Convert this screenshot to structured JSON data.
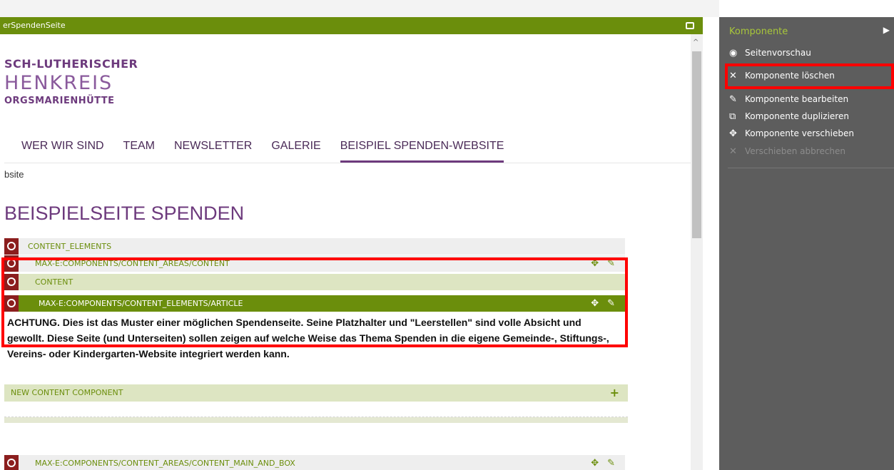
{
  "window": {
    "title": "erSpendenSeite"
  },
  "site": {
    "logo_line1": "SCH-LUTHERISCHER",
    "logo_line2": "HENKREIS",
    "logo_line3": "ORGSMARIENHÜTTE",
    "nav": [
      "WER WIR SIND",
      "TEAM",
      "NEWSLETTER",
      "GALERIE",
      "BEISPIEL SPENDEN-WEBSITE"
    ],
    "breadcrumb": "bsite",
    "page_title": "BEISPIELSEITE SPENDEN"
  },
  "components": {
    "content_elements": "CONTENT_ELEMENTS",
    "content_area": "MAX-E:COMPONENTS/CONTENT_AREAS/CONTENT",
    "content": "CONTENT",
    "article": "MAX-E:COMPONENTS/CONTENT_ELEMENTS/ARTICLE",
    "article_text": "ACHTUNG. Dies ist das Muster einer möglichen Spendenseite. Seine Platzhalter und \"Leerstellen\" sind volle Absicht und gewollt. Diese Seite (und Unterseiten) sollen zeigen auf welche Weise das Thema Spenden in die eigene Gemeinde-, Stiftungs-, Vereins- oder Kindergarten-Website integriert werden kann.",
    "new_component": "NEW CONTENT COMPONENT",
    "main_and_box": "MAX-E:COMPONENTS/CONTENT_AREAS/CONTENT_MAIN_AND_BOX"
  },
  "panel": {
    "title": "Komponente",
    "items": [
      {
        "label": "Seitenvorschau",
        "icon": "eye-icon"
      },
      {
        "label": "Komponente löschen",
        "icon": "close-icon"
      },
      {
        "label": "Komponente bearbeiten",
        "icon": "pencil-icon"
      },
      {
        "label": "Komponente duplizieren",
        "icon": "duplicate-icon"
      },
      {
        "label": "Komponente verschieben",
        "icon": "move-icon"
      },
      {
        "label": "Verschieben abbrechen",
        "icon": "cancel-icon"
      }
    ]
  },
  "colors": {
    "toolbar_green": "#6b8e0c",
    "brand_purple": "#6d3a7d",
    "panel_bg": "#5d5d5d",
    "highlight_red": "#ff0000"
  }
}
